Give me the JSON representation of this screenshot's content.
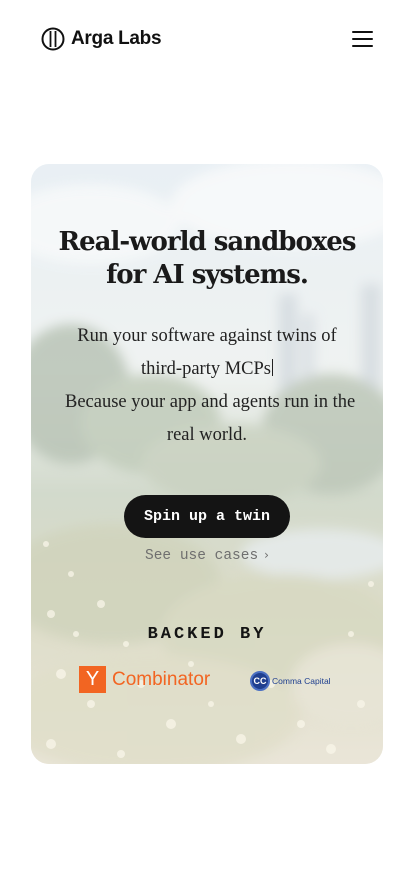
{
  "header": {
    "brand": "Arga Labs",
    "logo_icon": "arga-logo-icon",
    "menu_icon": "hamburger-menu-icon"
  },
  "hero": {
    "headline_line1": "Real-world sandboxes",
    "headline_line2": "for AI systems.",
    "sub_line1": "Run your software against twins of",
    "sub_line2": "third-party MCPs",
    "sub_line3": "Because your app and agents run in the",
    "sub_line4": "real world.",
    "cta_label": "Spin up a twin",
    "secondary_link": "See use cases",
    "backed_by": "BACKED BY"
  },
  "backers": {
    "yc_mark": "Y",
    "yc_name": "Combinator",
    "cc_mark": "CC",
    "cc_name": "Comma Capital"
  },
  "colors": {
    "cta_bg": "#141414",
    "yc_orange": "#f26522",
    "cc_blue": "#1f3f8f"
  }
}
